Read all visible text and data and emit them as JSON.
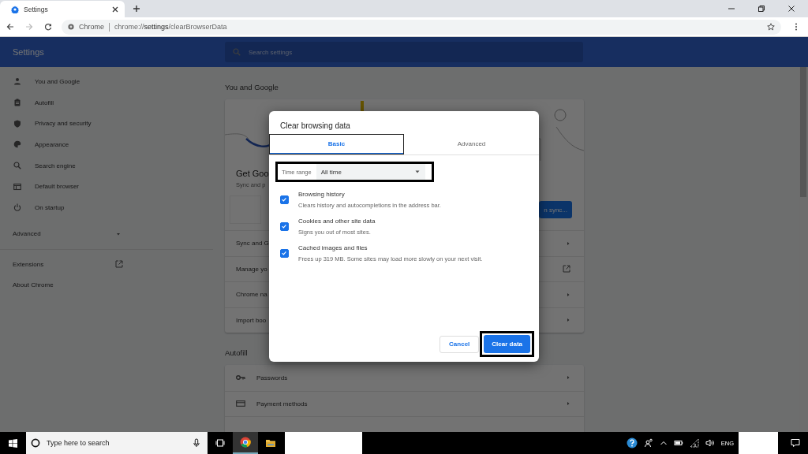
{
  "browser_tab": {
    "title": "Settings"
  },
  "address_bar": {
    "site_label": "Chrome",
    "url": "chrome://**settings**/clearBrowserData"
  },
  "header": {
    "title": "Settings",
    "search_placeholder": "Search settings"
  },
  "sidebar": {
    "items": [
      {
        "label": "You and Google"
      },
      {
        "label": "Autofill"
      },
      {
        "label": "Privacy and security"
      },
      {
        "label": "Appearance"
      },
      {
        "label": "Search engine"
      },
      {
        "label": "Default browser"
      },
      {
        "label": "On startup"
      }
    ],
    "advanced": {
      "label": "Advanced",
      "expanded": false
    },
    "links": [
      {
        "label": "Extensions",
        "kind": "external"
      },
      {
        "label": "About Chrome",
        "kind": "plain"
      }
    ]
  },
  "you_and_google": {
    "heading": "You and Google",
    "promo_title": "Get Goo",
    "promo_text": "Sync and p",
    "sync_button": "n sync...",
    "rows": [
      {
        "label": "Sync and G",
        "kind": "arrow"
      },
      {
        "label": "Manage yo",
        "kind": "external"
      },
      {
        "label": "Chrome na",
        "kind": "arrow"
      },
      {
        "label": "Import boo",
        "kind": "arrow"
      }
    ]
  },
  "autofill": {
    "heading": "Autofill",
    "rows": [
      {
        "label": "Passwords",
        "kind": "arrow"
      },
      {
        "label": "Payment methods",
        "kind": "arrow"
      }
    ]
  },
  "dialog": {
    "title": "Clear browsing data",
    "tabs": [
      {
        "label": "Basic",
        "selected": true,
        "highlighted": true
      },
      {
        "label": "Advanced",
        "selected": false,
        "highlighted": false
      }
    ],
    "time_range": {
      "label": "Time range",
      "value": "All time",
      "highlighted": true
    },
    "options": [
      {
        "label": "Browsing history",
        "description": "Clears history and autocompletions in the address bar.",
        "checked": true
      },
      {
        "label": "Cookies and other site data",
        "description": "Signs you out of most sites.",
        "checked": true
      },
      {
        "label": "Cached images and files",
        "description": "Frees up 319 MB. Some sites may load more slowly on your next visit.",
        "checked": true
      }
    ],
    "cancel_button": "Cancel",
    "confirm_button": {
      "label": "Clear data",
      "highlighted": true
    }
  },
  "taskbar": {
    "search_placeholder": "Type here to search",
    "language": "ENG",
    "apps": [
      {
        "kind": "browser",
        "selected": true
      },
      {
        "kind": "folder",
        "selected": false
      }
    ]
  }
}
